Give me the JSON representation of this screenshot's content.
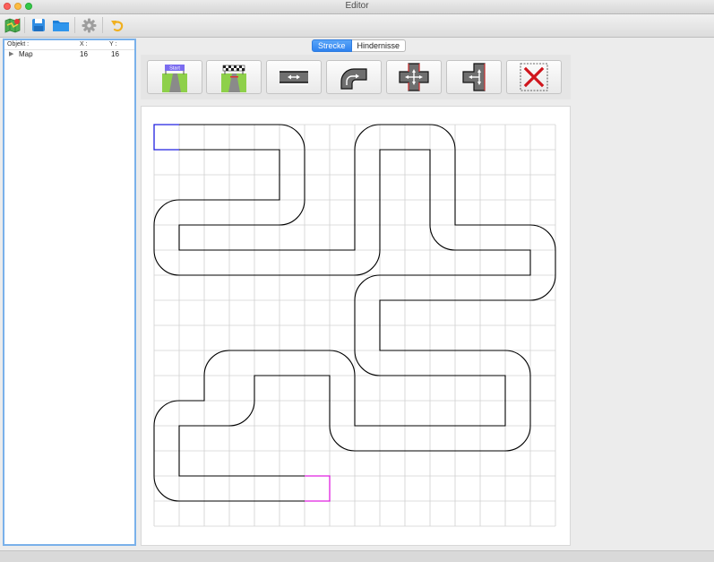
{
  "window": {
    "title": "Editor"
  },
  "toolbar": {
    "buttons": [
      {
        "name": "map-icon"
      },
      {
        "name": "save-icon"
      },
      {
        "name": "folder-icon"
      },
      {
        "name": "gear-icon"
      },
      {
        "name": "undo-icon"
      }
    ]
  },
  "tree": {
    "headers": {
      "object": "Objekt :",
      "x": "X :",
      "y": "Y :"
    },
    "rows": [
      {
        "label": "Map",
        "x": "16",
        "y": "16"
      }
    ]
  },
  "tabs": {
    "strecke": "Strecke",
    "hindernisse": "Hindernisse",
    "active": "Strecke"
  },
  "tiles": {
    "start_label": "Start",
    "items": [
      {
        "name": "start-tile"
      },
      {
        "name": "finish-tile"
      },
      {
        "name": "straight-tile"
      },
      {
        "name": "curve-tile"
      },
      {
        "name": "cross-tile"
      },
      {
        "name": "t-junction-tile"
      },
      {
        "name": "delete-tile"
      }
    ]
  },
  "grid": {
    "columns": 16,
    "rows": 16
  },
  "colors": {
    "accent": "#2e82ef",
    "start_marker": "#2020e0",
    "end_marker": "#e020e0",
    "delete": "#d0151c"
  }
}
